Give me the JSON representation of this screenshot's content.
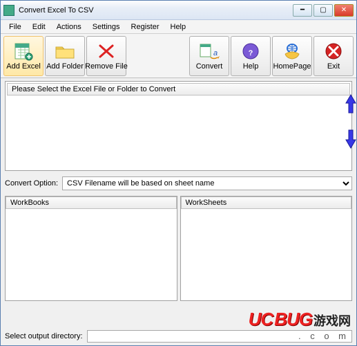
{
  "window": {
    "title": "Convert Excel To CSV"
  },
  "menu": {
    "file": "File",
    "edit": "Edit",
    "actions": "Actions",
    "settings": "Settings",
    "register": "Register",
    "help": "Help"
  },
  "toolbar": {
    "add_excel": "Add Excel",
    "add_folder": "Add Folder",
    "remove_file": "Remove File",
    "convert": "Convert",
    "help": "Help",
    "homepage": "HomePage",
    "exit": "Exit"
  },
  "filelist": {
    "header": "Please Select the Excel File or Folder to Convert"
  },
  "convert_option": {
    "label": "Convert Option:",
    "selected": "CSV Filename will be based on sheet name"
  },
  "panes": {
    "workbooks": "WorkBooks",
    "worksheets": "WorkSheets"
  },
  "output": {
    "label": "Select  output directory:",
    "value": ""
  },
  "watermark": {
    "uc": "UC",
    "bug": "BUG",
    "cn": "游戏网",
    "com": ". c o m"
  }
}
